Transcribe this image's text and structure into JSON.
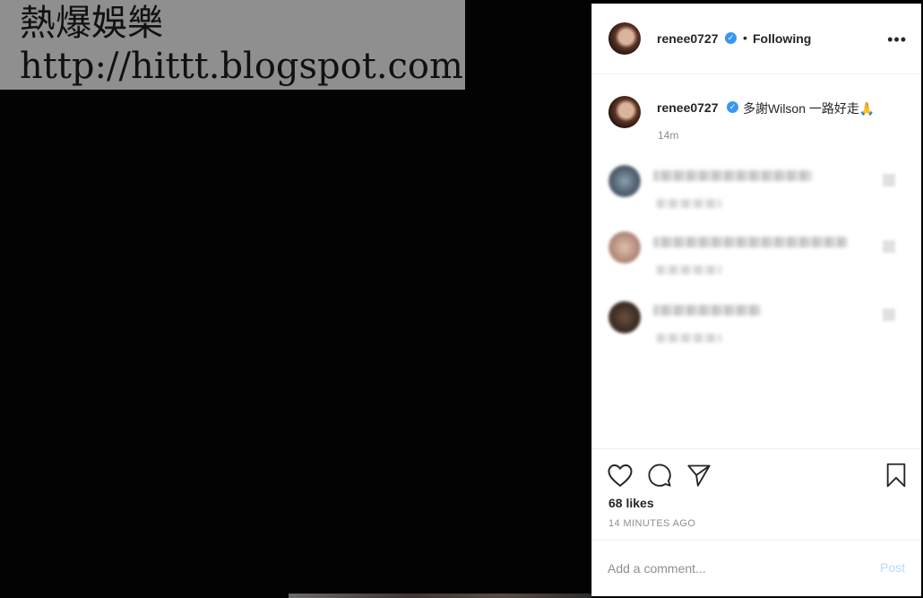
{
  "watermark": {
    "line1": "熱爆娛樂",
    "line2": "http://hittt.blogspot.com"
  },
  "header": {
    "username": "renee0727",
    "verified_icon": "verified-badge-icon",
    "separator": "•",
    "follow_status": "Following",
    "more_icon": "more-options-icon"
  },
  "caption": {
    "username": "renee0727",
    "text": "多謝Wilson 一路好走🙏",
    "time": "14m"
  },
  "actions": {
    "like_icon": "heart-icon",
    "comment_icon": "comment-icon",
    "share_icon": "share-icon",
    "save_icon": "bookmark-icon",
    "likes": "68 likes",
    "posted_ago": "14 MINUTES AGO"
  },
  "comment_box": {
    "placeholder": "Add a comment...",
    "post_label": "Post"
  },
  "colors": {
    "accent": "#3897f0",
    "post_disabled": "#b3dbff",
    "text": "#262626",
    "muted": "#8e8e8e"
  }
}
